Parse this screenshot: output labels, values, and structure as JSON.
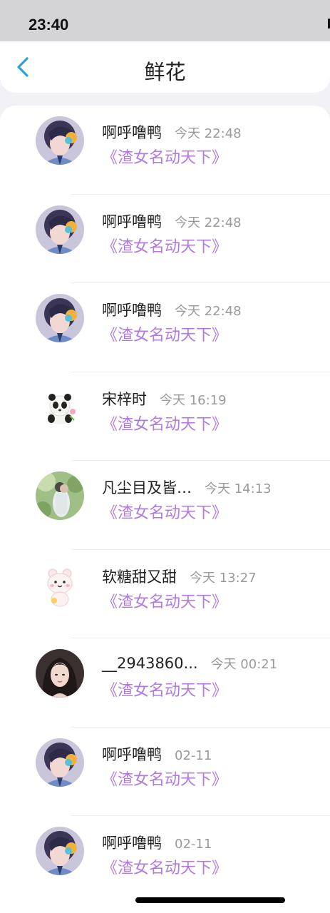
{
  "status": {
    "time": "23:40"
  },
  "header": {
    "title": "鲜花",
    "back_icon": "chevron-left-icon",
    "accent": "#2f9fe0"
  },
  "book_color": "#b07ae0",
  "items": [
    {
      "name": "啊呼噜鸭",
      "time": "今天 22:48",
      "book": "《渣女名动天下》",
      "avatar": "anime-boy-avatar"
    },
    {
      "name": "啊呼噜鸭",
      "time": "今天 22:48",
      "book": "《渣女名动天下》",
      "avatar": "anime-boy-avatar"
    },
    {
      "name": "啊呼噜鸭",
      "time": "今天 22:48",
      "book": "《渣女名动天下》",
      "avatar": "anime-boy-avatar"
    },
    {
      "name": "宋梓时",
      "time": "今天 16:19",
      "book": "《渣女名动天下》",
      "avatar": "panda-avatar"
    },
    {
      "name": "凡尘目及皆…",
      "time": "今天 14:13",
      "book": "《渣女名动天下》",
      "avatar": "couple-photo-avatar"
    },
    {
      "name": "软糖甜又甜",
      "time": "今天 13:27",
      "book": "《渣女名动天下》",
      "avatar": "bear-sticker-avatar"
    },
    {
      "name": "__2943860...",
      "time": "今天 00:21",
      "book": "《渣女名动天下》",
      "avatar": "girl-photo-avatar"
    },
    {
      "name": "啊呼噜鸭",
      "time": "02-11",
      "book": "《渣女名动天下》",
      "avatar": "anime-boy-avatar"
    },
    {
      "name": "啊呼噜鸭",
      "time": "02-11",
      "book": "《渣女名动天下》",
      "avatar": "anime-boy-avatar"
    }
  ]
}
